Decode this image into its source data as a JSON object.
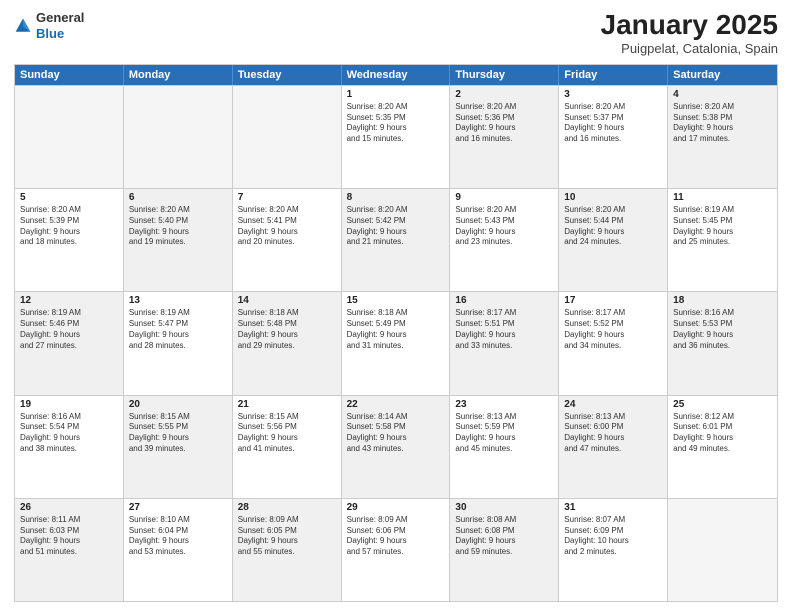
{
  "logo": {
    "general": "General",
    "blue": "Blue"
  },
  "header": {
    "title": "January 2025",
    "subtitle": "Puigpelat, Catalonia, Spain"
  },
  "weekdays": [
    "Sunday",
    "Monday",
    "Tuesday",
    "Wednesday",
    "Thursday",
    "Friday",
    "Saturday"
  ],
  "rows": [
    [
      {
        "day": "",
        "lines": [],
        "empty": true
      },
      {
        "day": "",
        "lines": [],
        "empty": true
      },
      {
        "day": "",
        "lines": [],
        "empty": true
      },
      {
        "day": "1",
        "lines": [
          "Sunrise: 8:20 AM",
          "Sunset: 5:35 PM",
          "Daylight: 9 hours",
          "and 15 minutes."
        ]
      },
      {
        "day": "2",
        "lines": [
          "Sunrise: 8:20 AM",
          "Sunset: 5:36 PM",
          "Daylight: 9 hours",
          "and 16 minutes."
        ],
        "shaded": true
      },
      {
        "day": "3",
        "lines": [
          "Sunrise: 8:20 AM",
          "Sunset: 5:37 PM",
          "Daylight: 9 hours",
          "and 16 minutes."
        ]
      },
      {
        "day": "4",
        "lines": [
          "Sunrise: 8:20 AM",
          "Sunset: 5:38 PM",
          "Daylight: 9 hours",
          "and 17 minutes."
        ],
        "shaded": true
      }
    ],
    [
      {
        "day": "5",
        "lines": [
          "Sunrise: 8:20 AM",
          "Sunset: 5:39 PM",
          "Daylight: 9 hours",
          "and 18 minutes."
        ]
      },
      {
        "day": "6",
        "lines": [
          "Sunrise: 8:20 AM",
          "Sunset: 5:40 PM",
          "Daylight: 9 hours",
          "and 19 minutes."
        ],
        "shaded": true
      },
      {
        "day": "7",
        "lines": [
          "Sunrise: 8:20 AM",
          "Sunset: 5:41 PM",
          "Daylight: 9 hours",
          "and 20 minutes."
        ]
      },
      {
        "day": "8",
        "lines": [
          "Sunrise: 8:20 AM",
          "Sunset: 5:42 PM",
          "Daylight: 9 hours",
          "and 21 minutes."
        ],
        "shaded": true
      },
      {
        "day": "9",
        "lines": [
          "Sunrise: 8:20 AM",
          "Sunset: 5:43 PM",
          "Daylight: 9 hours",
          "and 23 minutes."
        ]
      },
      {
        "day": "10",
        "lines": [
          "Sunrise: 8:20 AM",
          "Sunset: 5:44 PM",
          "Daylight: 9 hours",
          "and 24 minutes."
        ],
        "shaded": true
      },
      {
        "day": "11",
        "lines": [
          "Sunrise: 8:19 AM",
          "Sunset: 5:45 PM",
          "Daylight: 9 hours",
          "and 25 minutes."
        ]
      }
    ],
    [
      {
        "day": "12",
        "lines": [
          "Sunrise: 8:19 AM",
          "Sunset: 5:46 PM",
          "Daylight: 9 hours",
          "and 27 minutes."
        ],
        "shaded": true
      },
      {
        "day": "13",
        "lines": [
          "Sunrise: 8:19 AM",
          "Sunset: 5:47 PM",
          "Daylight: 9 hours",
          "and 28 minutes."
        ]
      },
      {
        "day": "14",
        "lines": [
          "Sunrise: 8:18 AM",
          "Sunset: 5:48 PM",
          "Daylight: 9 hours",
          "and 29 minutes."
        ],
        "shaded": true
      },
      {
        "day": "15",
        "lines": [
          "Sunrise: 8:18 AM",
          "Sunset: 5:49 PM",
          "Daylight: 9 hours",
          "and 31 minutes."
        ]
      },
      {
        "day": "16",
        "lines": [
          "Sunrise: 8:17 AM",
          "Sunset: 5:51 PM",
          "Daylight: 9 hours",
          "and 33 minutes."
        ],
        "shaded": true
      },
      {
        "day": "17",
        "lines": [
          "Sunrise: 8:17 AM",
          "Sunset: 5:52 PM",
          "Daylight: 9 hours",
          "and 34 minutes."
        ]
      },
      {
        "day": "18",
        "lines": [
          "Sunrise: 8:16 AM",
          "Sunset: 5:53 PM",
          "Daylight: 9 hours",
          "and 36 minutes."
        ],
        "shaded": true
      }
    ],
    [
      {
        "day": "19",
        "lines": [
          "Sunrise: 8:16 AM",
          "Sunset: 5:54 PM",
          "Daylight: 9 hours",
          "and 38 minutes."
        ]
      },
      {
        "day": "20",
        "lines": [
          "Sunrise: 8:15 AM",
          "Sunset: 5:55 PM",
          "Daylight: 9 hours",
          "and 39 minutes."
        ],
        "shaded": true
      },
      {
        "day": "21",
        "lines": [
          "Sunrise: 8:15 AM",
          "Sunset: 5:56 PM",
          "Daylight: 9 hours",
          "and 41 minutes."
        ]
      },
      {
        "day": "22",
        "lines": [
          "Sunrise: 8:14 AM",
          "Sunset: 5:58 PM",
          "Daylight: 9 hours",
          "and 43 minutes."
        ],
        "shaded": true
      },
      {
        "day": "23",
        "lines": [
          "Sunrise: 8:13 AM",
          "Sunset: 5:59 PM",
          "Daylight: 9 hours",
          "and 45 minutes."
        ]
      },
      {
        "day": "24",
        "lines": [
          "Sunrise: 8:13 AM",
          "Sunset: 6:00 PM",
          "Daylight: 9 hours",
          "and 47 minutes."
        ],
        "shaded": true
      },
      {
        "day": "25",
        "lines": [
          "Sunrise: 8:12 AM",
          "Sunset: 6:01 PM",
          "Daylight: 9 hours",
          "and 49 minutes."
        ]
      }
    ],
    [
      {
        "day": "26",
        "lines": [
          "Sunrise: 8:11 AM",
          "Sunset: 6:03 PM",
          "Daylight: 9 hours",
          "and 51 minutes."
        ],
        "shaded": true
      },
      {
        "day": "27",
        "lines": [
          "Sunrise: 8:10 AM",
          "Sunset: 6:04 PM",
          "Daylight: 9 hours",
          "and 53 minutes."
        ]
      },
      {
        "day": "28",
        "lines": [
          "Sunrise: 8:09 AM",
          "Sunset: 6:05 PM",
          "Daylight: 9 hours",
          "and 55 minutes."
        ],
        "shaded": true
      },
      {
        "day": "29",
        "lines": [
          "Sunrise: 8:09 AM",
          "Sunset: 6:06 PM",
          "Daylight: 9 hours",
          "and 57 minutes."
        ]
      },
      {
        "day": "30",
        "lines": [
          "Sunrise: 8:08 AM",
          "Sunset: 6:08 PM",
          "Daylight: 9 hours",
          "and 59 minutes."
        ],
        "shaded": true
      },
      {
        "day": "31",
        "lines": [
          "Sunrise: 8:07 AM",
          "Sunset: 6:09 PM",
          "Daylight: 10 hours",
          "and 2 minutes."
        ]
      },
      {
        "day": "",
        "lines": [],
        "empty": true
      }
    ]
  ]
}
